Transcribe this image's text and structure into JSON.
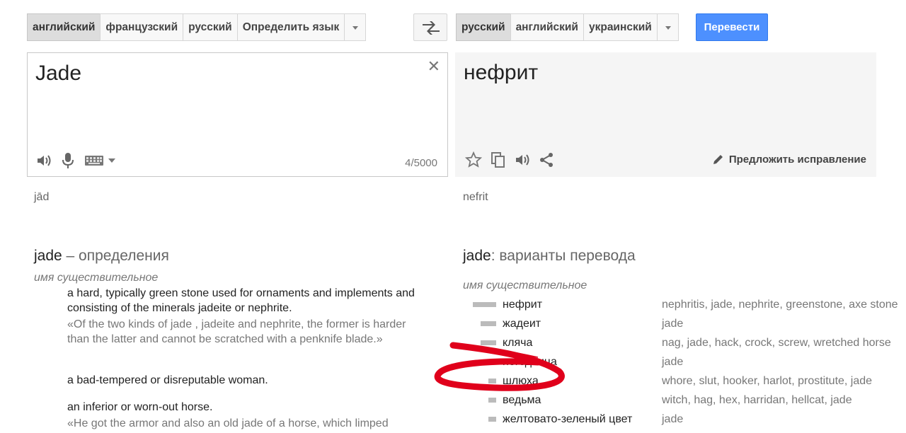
{
  "source_langs": [
    "английский",
    "французский",
    "русский",
    "Определить язык"
  ],
  "target_langs": [
    "русский",
    "английский",
    "украинский"
  ],
  "translate_button": "Перевести",
  "source": {
    "text": "Jade",
    "counter": "4/5000",
    "transliteration": "jād"
  },
  "target": {
    "text": "нефрит",
    "suggest_label": "Предложить исправление",
    "transliteration": "nefrit"
  },
  "definitions": {
    "word": "jade",
    "title_suffix": "– определения",
    "pos": "имя существительное",
    "items": [
      {
        "def": "a hard, typically green stone used for ornaments and implements and consisting of the minerals jadeite or nephrite.",
        "example": "«Of the two kinds of jade , jadeite and nephrite, the former is harder than the latter and cannot be scratched with a penknife blade.»"
      },
      {
        "def": "a bad-tempered or disreputable woman."
      },
      {
        "def": "an inferior or worn-out horse.",
        "example": "«He got the armor and also an old jade of a horse, which limped"
      }
    ]
  },
  "translations": {
    "word": "jade",
    "title_suffix": ": варианты перевода",
    "pos": "имя существительное",
    "rows": [
      {
        "word": "нефрит",
        "synonyms": "nephritis, jade, nephrite, greenstone, axe stone",
        "frequency": 1.0
      },
      {
        "word": "жадеит",
        "synonyms": "jade",
        "frequency": 0.66
      },
      {
        "word": "кляча",
        "synonyms": "nag, jade, hack, crock, screw, wretched horse",
        "frequency": 0.66
      },
      {
        "word": "негодница",
        "synonyms": "jade",
        "frequency": 0.33
      },
      {
        "word": "шлюха",
        "synonyms": "whore, slut, hooker, harlot, prostitute, jade",
        "frequency": 0.33
      },
      {
        "word": "ведьма",
        "synonyms": "witch, hag, hex, harridan, hellcat, jade",
        "frequency": 0.33
      },
      {
        "word": "желтовато-зеленый цвет",
        "synonyms": "jade",
        "frequency": 0.33
      }
    ]
  },
  "icons": {
    "swap": "swap-arrows-icon",
    "clear": "close-icon",
    "speaker": "speaker-icon",
    "mic": "microphone-icon",
    "keyboard": "keyboard-icon",
    "star": "star-icon",
    "copy": "copy-icon",
    "share": "share-icon",
    "pencil": "pencil-icon"
  },
  "colors": {
    "accent": "#4d90fe",
    "annotation": "#e0001b"
  }
}
